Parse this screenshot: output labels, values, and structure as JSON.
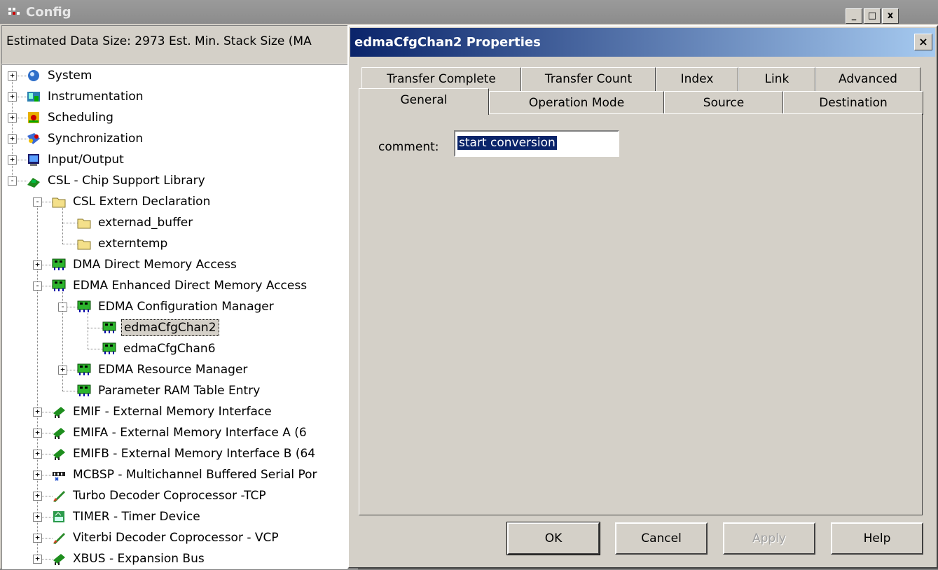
{
  "main_window": {
    "title": "Config",
    "controls": [
      "_",
      "□",
      "x"
    ],
    "status_text": "Estimated Data Size: 2973   Est. Min. Stack Size (MA"
  },
  "tree": [
    {
      "label": "System",
      "icon": "system-icon",
      "exp": "+"
    },
    {
      "label": "Instrumentation",
      "icon": "instrumentation-icon",
      "exp": "+"
    },
    {
      "label": "Scheduling",
      "icon": "scheduling-icon",
      "exp": "+"
    },
    {
      "label": "Synchronization",
      "icon": "synchronization-icon",
      "exp": "+"
    },
    {
      "label": "Input/Output",
      "icon": "input-output-icon",
      "exp": "+"
    },
    {
      "label": "CSL - Chip Support Library",
      "icon": "chip-icon",
      "exp": "-"
    },
    {
      "label": "CSL Extern Declaration",
      "icon": "folder-icon",
      "exp": "-"
    },
    {
      "label": "externad_buffer",
      "icon": "folder-icon",
      "exp": ""
    },
    {
      "label": "externtemp",
      "icon": "folder-icon",
      "exp": ""
    },
    {
      "label": "DMA Direct Memory Access",
      "icon": "board-icon",
      "exp": "+"
    },
    {
      "label": "EDMA Enhanced Direct Memory Access",
      "icon": "board-icon",
      "exp": "-"
    },
    {
      "label": "EDMA Configuration Manager",
      "icon": "board-icon",
      "exp": "-"
    },
    {
      "label": "edmaCfgChan2",
      "icon": "board-icon",
      "exp": ""
    },
    {
      "label": "edmaCfgChan6",
      "icon": "board-icon",
      "exp": ""
    },
    {
      "label": "EDMA Resource Manager",
      "icon": "board-icon",
      "exp": "+"
    },
    {
      "label": "Parameter RAM Table Entry",
      "icon": "board-icon",
      "exp": ""
    },
    {
      "label": "EMIF - External Memory Interface",
      "icon": "memory-chip-icon",
      "exp": "+"
    },
    {
      "label": "EMIFA - External Memory Interface A (6",
      "icon": "memory-chip-icon",
      "exp": "+"
    },
    {
      "label": "EMIFB - External Memory Interface B (64",
      "icon": "memory-chip-icon",
      "exp": "+"
    },
    {
      "label": "MCBSP - Multichannel Buffered Serial Por",
      "icon": "serial-port-icon",
      "exp": "+"
    },
    {
      "label": "Turbo Decoder Coprocessor -TCP",
      "icon": "rocket-icon",
      "exp": "+"
    },
    {
      "label": "TIMER - Timer Device",
      "icon": "timer-icon",
      "exp": "+"
    },
    {
      "label": "Viterbi Decoder Coprocessor - VCP",
      "icon": "rocket-icon",
      "exp": "+"
    },
    {
      "label": "XBUS - Expansion Bus",
      "icon": "memory-chip-icon",
      "exp": "+"
    }
  ],
  "dialog": {
    "title": "edmaCfgChan2 Properties",
    "close": "×",
    "tabs_back": [
      "Transfer Complete",
      "Transfer Count",
      "Index",
      "Link",
      "Advanced"
    ],
    "tabs_front": [
      "General",
      "Operation Mode",
      "Source",
      "Destination"
    ],
    "active_tab": "General",
    "comment_label": "comment:",
    "comment_value": "start conversion",
    "buttons": {
      "ok": "OK",
      "cancel": "Cancel",
      "apply": "Apply",
      "help": "Help"
    }
  }
}
